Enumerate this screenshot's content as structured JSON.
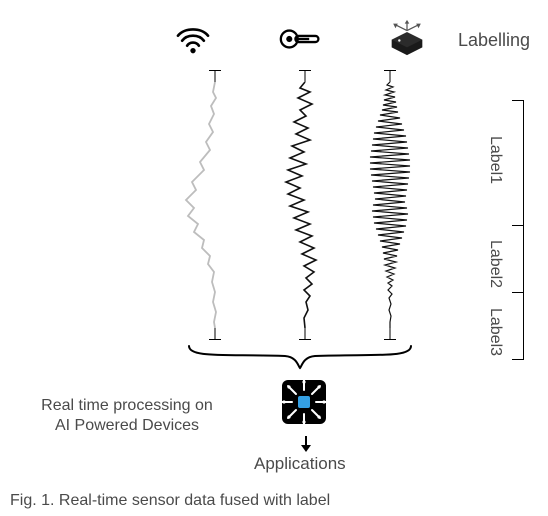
{
  "labelling_text": "Labelling",
  "axis_labels": {
    "label1": "Label1",
    "label2": "Label2",
    "label3": "Label3"
  },
  "left_text": {
    "line1": "Real time processing on",
    "line2": "AI Powered Devices"
  },
  "applications_text": "Applications",
  "caption_text": "Fig. 1. Real-time sensor data fused with label",
  "icons": {
    "wifi": "wifi-icon",
    "thermometer": "thermometer-icon",
    "imu": "imu-icon",
    "chip": "ai-chip-icon"
  },
  "colors": {
    "text": "#4a4a4a",
    "wave_light": "#bdbdbd",
    "wave_dark": "#111111",
    "chip_bg": "#000000",
    "chip_core": "#34a0e4"
  }
}
